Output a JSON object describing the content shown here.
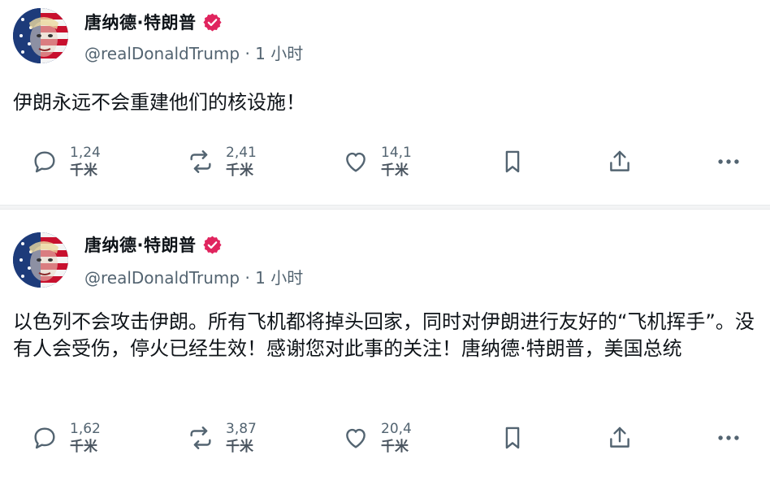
{
  "posts": [
    {
      "author": {
        "name": "唐纳德·特朗普",
        "handle": "@realDonaldTrump",
        "separator": "·",
        "time": "1 小时"
      },
      "text": "伊朗永远不会重建他们的核设施！",
      "stats": {
        "replies": {
          "number": "1,24",
          "unit": "千米"
        },
        "reposts": {
          "number": "2,41",
          "unit": "千米"
        },
        "likes": {
          "number": "14,1",
          "unit": "千米"
        }
      }
    },
    {
      "author": {
        "name": "唐纳德·特朗普",
        "handle": "@realDonaldTrump",
        "separator": "·",
        "time": "1 小时"
      },
      "text": "以色列不会攻击伊朗。所有飞机都将掉头回家，同时对伊朗进行友好的“飞机挥手”。没有人会受伤，停火已经生效！感谢您对此事的关注！唐纳德·特朗普，美国总统",
      "stats": {
        "replies": {
          "number": "1,62",
          "unit": "千米"
        },
        "reposts": {
          "number": "3,87",
          "unit": "千米"
        },
        "likes": {
          "number": "20,4",
          "unit": "千米"
        }
      }
    }
  ],
  "icons": {
    "reply": "reply-icon",
    "repost": "repost-icon",
    "like": "like-icon",
    "bookmark": "bookmark-icon",
    "share": "share-icon",
    "more": "more-icon",
    "verified": "verified-badge-icon"
  },
  "colors": {
    "text_primary": "#0f1419",
    "text_secondary": "#536471",
    "verified_badge": "#e0245e",
    "divider": "#f3f4f5"
  }
}
